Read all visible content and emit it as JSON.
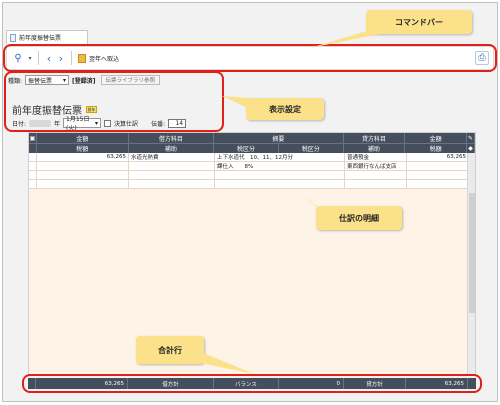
{
  "window": {
    "tab_label": "前年度振替伝票"
  },
  "toolbar": {
    "search_icon": "search-icon",
    "dropdown_icon": "chevron-down-icon",
    "back_icon": "chevron-left-icon",
    "forward_icon": "chevron-right-icon",
    "import_label": "翌年へ取込",
    "print_icon": "printer-icon"
  },
  "settings": {
    "kind_label": "種類:",
    "kind_value": "振替伝票",
    "registered_label": "[登録済]",
    "library_button": "伝票ライブラリ参照",
    "document_title": "前年度振替伝票",
    "title_badge": "前年",
    "date_label": "日付:",
    "year_suffix": "年",
    "date_value": "1月15日(火)",
    "settlement_label": "決算仕訳",
    "slip_no_label": "伝番:",
    "slip_no_value": "14"
  },
  "grid": {
    "header_row1": [
      "金額",
      "借方科目",
      "摘要",
      "貸方科目",
      "金額"
    ],
    "header_row2": [
      "税額",
      "補助",
      "税区分",
      "税区分",
      "補助",
      "税額"
    ],
    "rows": [
      [
        "63,265",
        "水道光熱費",
        "上下水道代　10、11、12月分",
        "",
        "普通預金",
        "63,265"
      ],
      [
        "",
        "",
        "課仕入　　8%",
        "",
        "東西銀行なんば支店",
        ""
      ]
    ]
  },
  "totals": {
    "debit_amount": "63,265",
    "debit_label": "借方計",
    "balance_label": "バランス",
    "balance_value": "0",
    "credit_label": "貸方計",
    "credit_amount": "63,265"
  },
  "callouts": {
    "command_bar": "コマンドバー",
    "display_settings": "表示設定",
    "journal_detail": "仕訳の明細",
    "total_row": "合計行"
  },
  "colors": {
    "callout_bg": "#fbe18a",
    "highlight_border": "#e0201a",
    "grid_header": "#454e5c",
    "grid_body": "#fdf3e6"
  }
}
